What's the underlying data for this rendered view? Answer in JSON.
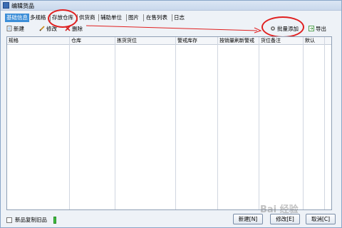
{
  "window": {
    "title": "编辑货品"
  },
  "tabs": [
    {
      "label": "基础信息"
    },
    {
      "label": "多规格"
    },
    {
      "label": "存放仓库"
    },
    {
      "label": "供货商"
    },
    {
      "label": "辅助单位"
    },
    {
      "label": "图片"
    },
    {
      "label": "在售列表"
    },
    {
      "label": "日志"
    }
  ],
  "toolbar": {
    "new_label": "新建",
    "edit_label": "修改",
    "delete_label": "删除",
    "batch_add_label": "批量添加",
    "export_label": "导出"
  },
  "table": {
    "columns": [
      "规格",
      "仓库",
      "拣货货位",
      "警戒库存",
      "按销量刷新警戒",
      "货位备注",
      "默认"
    ]
  },
  "footer": {
    "copy_old_label": "新品复制旧品",
    "new_button": "新建[N]",
    "edit_button": "修改[E]",
    "cancel_button": "取消[C]"
  },
  "watermark": "Bai 经验",
  "colors": {
    "active_tab": "#3c8ed8",
    "annotation": "#e02020"
  }
}
